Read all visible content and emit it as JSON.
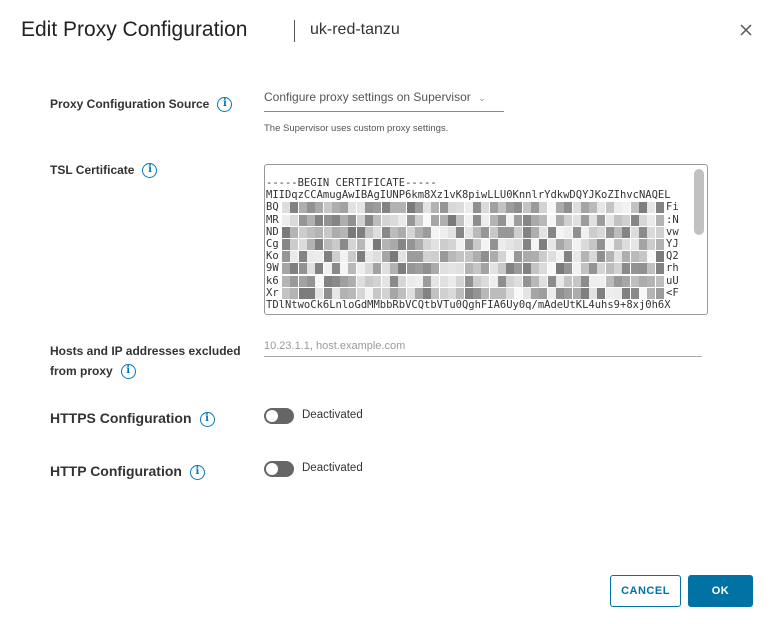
{
  "dialog": {
    "title": "Edit Proxy Configuration",
    "subtitle": "uk-red-tanzu"
  },
  "proxy_source": {
    "label": "Proxy Configuration Source",
    "value": "Configure proxy settings on Supervisor",
    "help": "The Supervisor uses custom proxy settings."
  },
  "certificate": {
    "label": "TSL Certificate",
    "lines": [
      "-----BEGIN CERTIFICATE-----",
      "MIIDqzCCAmugAwIBAgIUNP6km8Xz1vK8piwLLU0KnnlrYdkwDQYJKoZIhvcNAQEL",
      "BQ",
      "MR",
      "ND",
      "Cg",
      "Ko",
      "9W",
      "k6",
      "Xr",
      "TDlNtwoCk6LnloGdMMbbRbVCQtbVTu0QghFIA6Uy0q/mAdeUtKL4uhs9+8xj0h6X"
    ],
    "line_ends": [
      "",
      "",
      "Fi",
      ":N",
      "vw",
      "YJ",
      "Q2",
      "rh",
      "uU",
      "<F",
      ""
    ]
  },
  "hosts": {
    "label_line1": "Hosts and IP addresses excluded",
    "label_line2": "from proxy",
    "placeholder": "10.23.1.1, host.example.com"
  },
  "https": {
    "label": "HTTPS Configuration",
    "state": "Deactivated",
    "enabled": false
  },
  "http": {
    "label": "HTTP Configuration",
    "state": "Deactivated",
    "enabled": false
  },
  "buttons": {
    "cancel": "CANCEL",
    "ok": "OK"
  },
  "colors": {
    "accent": "#0072a3"
  }
}
